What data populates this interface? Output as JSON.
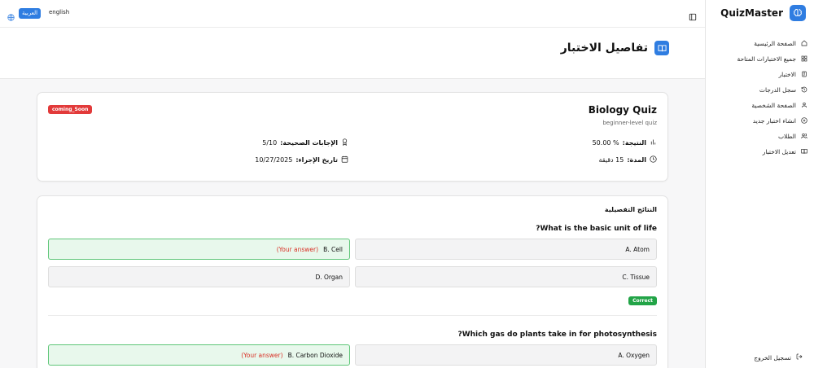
{
  "brand": {
    "name": "QuizMaster"
  },
  "sidebar": {
    "items": [
      {
        "label": "الصفحة الرئيسية",
        "icon": "home-icon"
      },
      {
        "label": "جميع الاختبارات المتاحة",
        "icon": "grid-icon"
      },
      {
        "label": "الاختبار",
        "icon": "clipboard-icon"
      },
      {
        "label": "سجل الدرجات",
        "icon": "history-icon"
      },
      {
        "label": "الصفحة الشخصية",
        "icon": "user-icon"
      },
      {
        "label": "انشاء اختبار جديد",
        "icon": "plus-circle-icon"
      },
      {
        "label": "الطلاب",
        "icon": "users-icon"
      },
      {
        "label": "تعديل الاختبار",
        "icon": "book-open-icon"
      }
    ],
    "logout": "تسجيل الخروج"
  },
  "topbar": {
    "lang_ar": "العربية",
    "lang_en": "english"
  },
  "page": {
    "title": "تفاصيل الاختبار"
  },
  "quiz": {
    "title": "Biology Quiz",
    "level": "beginner-level quiz",
    "status": "coming_Soon",
    "score_label": "النتيجة:",
    "score_value": "50.00 %",
    "correct_label": "الإجابات الصحيحة:",
    "correct_value": "5/10",
    "duration_label": "المدة:",
    "duration_value": "15 دقيقة",
    "date_label": "تاريخ الإجراء:",
    "date_value": "10/27/2025"
  },
  "results": {
    "title": "النتائج التفصيلية",
    "your_answer": "(Your answer)",
    "correct_badge": "Correct",
    "questions": [
      {
        "text": "?What is the basic unit of life",
        "options": [
          "A. Atom",
          "B. Cell",
          "C. Tissue",
          "D. Organ"
        ]
      },
      {
        "text": "?Which gas do plants take in for photosynthesis",
        "options": [
          "A. Oxygen",
          "B. Carbon Dioxide"
        ]
      }
    ]
  },
  "colors": {
    "accent": "#2f7de1",
    "danger": "#e23a3a",
    "success": "#22a447"
  }
}
